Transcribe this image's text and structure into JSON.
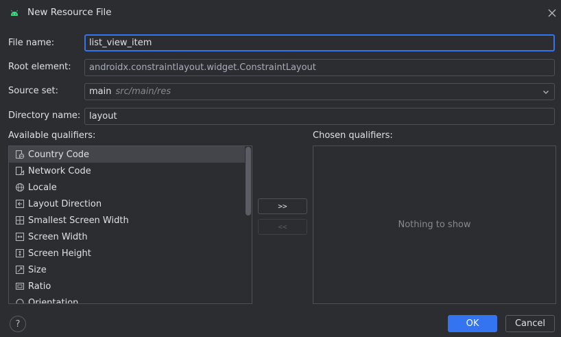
{
  "window": {
    "title": "New Resource File"
  },
  "form": {
    "file_name_label": "File name:",
    "file_name_value": "list_view_item",
    "root_element_label": "Root element:",
    "root_element_value": "androidx.constraintlayout.widget.ConstraintLayout",
    "source_set_label": "Source set:",
    "source_set_value": "main",
    "source_set_path": "src/main/res",
    "directory_name_label": "Directory name:",
    "directory_name_value": "layout"
  },
  "qualifiers": {
    "available_label": "Available qualifiers:",
    "chosen_label": "Chosen qualifiers:",
    "empty_text": "Nothing to show",
    "items": [
      {
        "label": "Country Code",
        "icon": "country-code-icon"
      },
      {
        "label": "Network Code",
        "icon": "network-code-icon"
      },
      {
        "label": "Locale",
        "icon": "globe-icon"
      },
      {
        "label": "Layout Direction",
        "icon": "layout-direction-icon"
      },
      {
        "label": "Smallest Screen Width",
        "icon": "smallest-width-icon"
      },
      {
        "label": "Screen Width",
        "icon": "screen-width-icon"
      },
      {
        "label": "Screen Height",
        "icon": "screen-height-icon"
      },
      {
        "label": "Size",
        "icon": "size-icon"
      },
      {
        "label": "Ratio",
        "icon": "ratio-icon"
      },
      {
        "label": "Orientation",
        "icon": "orientation-icon"
      }
    ],
    "add_label": ">>",
    "remove_label": "<<"
  },
  "footer": {
    "help_label": "?",
    "ok_label": "OK",
    "cancel_label": "Cancel"
  },
  "colors": {
    "accent": "#3574f0",
    "background": "#2b2d30",
    "android_green": "#3ddc84"
  }
}
